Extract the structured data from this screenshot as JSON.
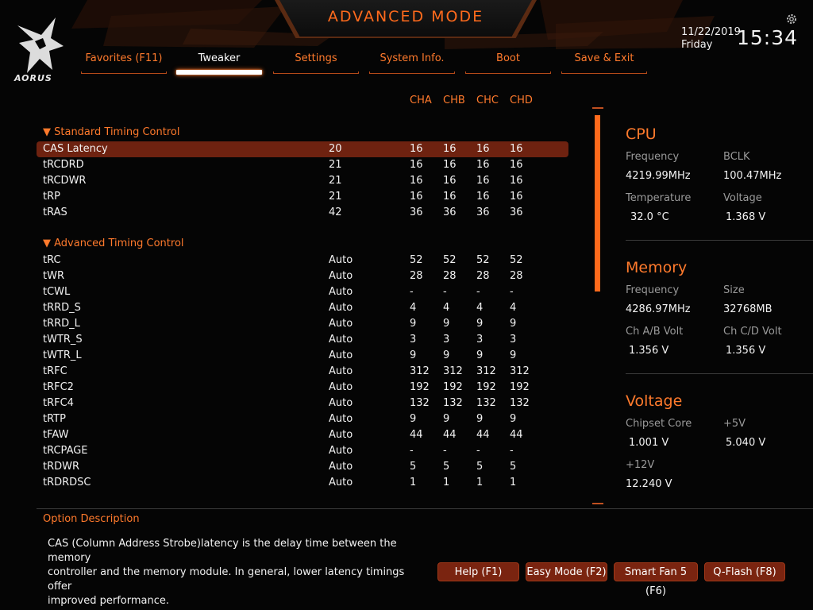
{
  "header": {
    "title": "ADVANCED MODE",
    "logo_text": "AORUS",
    "date": "11/22/2019",
    "weekday": "Friday",
    "time": "15:34"
  },
  "tabs": [
    {
      "label": "Favorites (F11)"
    },
    {
      "label": "Tweaker",
      "active": true
    },
    {
      "label": "Settings"
    },
    {
      "label": "System Info."
    },
    {
      "label": "Boot"
    },
    {
      "label": "Save & Exit"
    }
  ],
  "channels": [
    "CHA",
    "CHB",
    "CHC",
    "CHD"
  ],
  "sections": {
    "standard": "▼ Standard Timing Control",
    "advanced": "▼ Advanced Timing Control"
  },
  "standard_rows": [
    {
      "label": "CAS Latency",
      "value": "20",
      "ch": [
        "16",
        "16",
        "16",
        "16"
      ],
      "selected": true
    },
    {
      "label": "tRCDRD",
      "value": "21",
      "ch": [
        "16",
        "16",
        "16",
        "16"
      ]
    },
    {
      "label": "tRCDWR",
      "value": "21",
      "ch": [
        "16",
        "16",
        "16",
        "16"
      ]
    },
    {
      "label": "tRP",
      "value": "21",
      "ch": [
        "16",
        "16",
        "16",
        "16"
      ]
    },
    {
      "label": "tRAS",
      "value": "42",
      "ch": [
        "36",
        "36",
        "36",
        "36"
      ]
    }
  ],
  "advanced_rows": [
    {
      "label": "tRC",
      "value": "Auto",
      "ch": [
        "52",
        "52",
        "52",
        "52"
      ]
    },
    {
      "label": "tWR",
      "value": "Auto",
      "ch": [
        "28",
        "28",
        "28",
        "28"
      ]
    },
    {
      "label": "tCWL",
      "value": "Auto",
      "ch": [
        "-",
        "-",
        "-",
        "-"
      ]
    },
    {
      "label": "tRRD_S",
      "value": "Auto",
      "ch": [
        "4",
        "4",
        "4",
        "4"
      ]
    },
    {
      "label": "tRRD_L",
      "value": "Auto",
      "ch": [
        "9",
        "9",
        "9",
        "9"
      ]
    },
    {
      "label": "tWTR_S",
      "value": "Auto",
      "ch": [
        "3",
        "3",
        "3",
        "3"
      ]
    },
    {
      "label": "tWTR_L",
      "value": "Auto",
      "ch": [
        "9",
        "9",
        "9",
        "9"
      ]
    },
    {
      "label": "tRFC",
      "value": "Auto",
      "ch": [
        "312",
        "312",
        "312",
        "312"
      ]
    },
    {
      "label": "tRFC2",
      "value": "Auto",
      "ch": [
        "192",
        "192",
        "192",
        "192"
      ]
    },
    {
      "label": "tRFC4",
      "value": "Auto",
      "ch": [
        "132",
        "132",
        "132",
        "132"
      ]
    },
    {
      "label": "tRTP",
      "value": "Auto",
      "ch": [
        "9",
        "9",
        "9",
        "9"
      ]
    },
    {
      "label": "tFAW",
      "value": "Auto",
      "ch": [
        "44",
        "44",
        "44",
        "44"
      ]
    },
    {
      "label": "tRCPAGE",
      "value": "Auto",
      "ch": [
        "-",
        "-",
        "-",
        "-"
      ]
    },
    {
      "label": "tRDWR",
      "value": "Auto",
      "ch": [
        "5",
        "5",
        "5",
        "5"
      ]
    },
    {
      "label": "tRDRDSC",
      "value": "Auto",
      "ch": [
        "1",
        "1",
        "1",
        "1"
      ]
    }
  ],
  "cpu": {
    "title": "CPU",
    "frequency_label": "Frequency",
    "frequency": "4219.99MHz",
    "bclk_label": "BCLK",
    "bclk": "100.47MHz",
    "temperature_label": "Temperature",
    "temperature": "32.0 °C",
    "voltage_label": "Voltage",
    "voltage": "1.368 V"
  },
  "memory": {
    "title": "Memory",
    "frequency_label": "Frequency",
    "frequency": "4286.97MHz",
    "size_label": "Size",
    "size": "32768MB",
    "chab_label": "Ch A/B Volt",
    "chab": "1.356 V",
    "chcd_label": "Ch C/D Volt",
    "chcd": "1.356 V"
  },
  "voltage": {
    "title": "Voltage",
    "chipset_label": "Chipset Core",
    "chipset": "1.001 V",
    "p5v_label": "+5V",
    "p5v": "5.040 V",
    "p12v_label": "+12V",
    "p12v": "12.240 V"
  },
  "option": {
    "title": "Option Description",
    "line1": "CAS (Column Address Strobe)latency is the delay time between the memory",
    "line2": "controller and the memory module. In general, lower latency timings offer",
    "line3": "improved performance."
  },
  "fkeys": [
    {
      "label": "Help (F1)"
    },
    {
      "label": "Easy Mode (F2)"
    },
    {
      "label": "Smart Fan 5 (F6)"
    },
    {
      "label": "Q-Flash (F8)"
    }
  ],
  "colors": {
    "accent": "#ff6a1c",
    "selected_row": "#6e2210",
    "button": "#7a2410"
  },
  "scrollbar": {
    "thumb_start": 0.01,
    "thumb_fraction": 0.45
  }
}
